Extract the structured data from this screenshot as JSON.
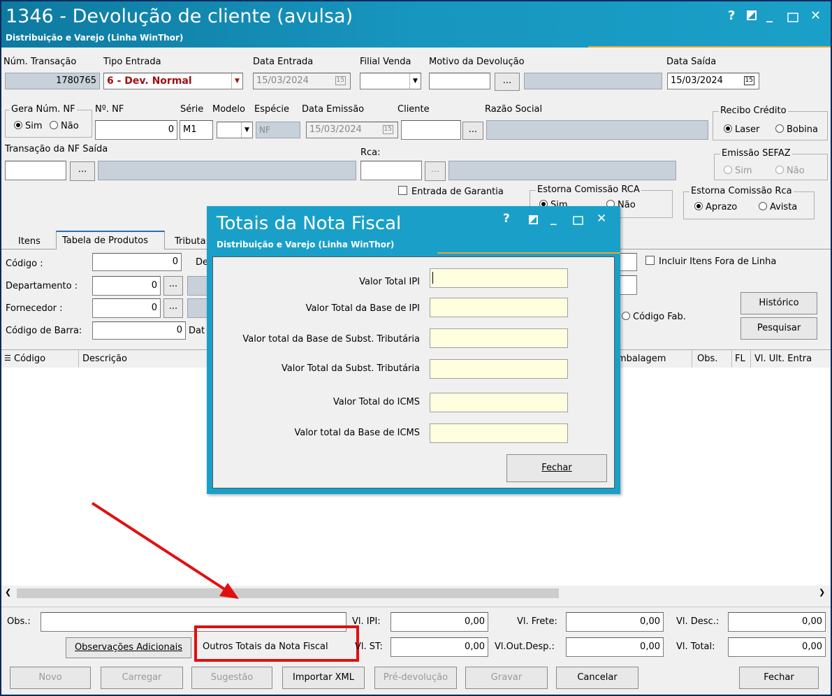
{
  "window": {
    "title": "1346 - Devolução de cliente (avulsa)",
    "subtitle": "Distribuição e Varejo (Linha WinThor)",
    "help": "?",
    "minimize": "_",
    "close": "✕"
  },
  "header": {
    "num_transacao_label": "Núm. Transação",
    "num_transacao_value": "1780765",
    "tipo_entrada_label": "Tipo Entrada",
    "tipo_entrada_value": "6 - Dev. Normal",
    "data_entrada_label": "Data Entrada",
    "data_entrada_value": "15/03/2024",
    "filial_venda_label": "Filial Venda",
    "motivo_label": "Motivo da Devolução",
    "data_saida_label": "Data Saída",
    "data_saida_value": "15/03/2024",
    "ellipsis": "..."
  },
  "nf": {
    "gera_label": "Gera Núm. NF",
    "sim": "Sim",
    "nao": "Não",
    "num_nf_label": "Nº. NF",
    "num_nf_value": "0",
    "serie_label": "Série",
    "serie_value": "M1",
    "modelo_label": "Modelo",
    "especie_label": "Espécie",
    "especie_value": "NF",
    "data_emissao_label": "Data Emissão",
    "data_emissao_value": "15/03/2024",
    "cliente_label": "Cliente",
    "razao_label": "Razão Social",
    "recibo_label": "Recibo Crédito",
    "laser": "Laser",
    "bobina": "Bobina",
    "transacao_saida_label": "Transação da NF Saída",
    "rca_label": "Rca:",
    "sefaz_label": "Emissão SEFAZ",
    "garantia_label": "Entrada de Garantia",
    "estorna_rca_label": "Estorna Comissão RCA",
    "estorna_rca_sim": "Sim",
    "estorna_rca_nao": "Não",
    "estorna_rca2_label": "Estorna Comissão Rca",
    "aprazo": "Aprazo",
    "avista": "Avista"
  },
  "tabs": {
    "itens": "Itens",
    "tabela": "Tabela de Produtos",
    "tributa": "Tributa"
  },
  "filters": {
    "codigo_label": "Código :",
    "codigo_value": "0",
    "de_label": "De",
    "departamento_label": "Departamento :",
    "departamento_value": "0",
    "fornecedor_label": "Fornecedor :",
    "fornecedor_value": "0",
    "codigo_barra_label": "Código de Barra:",
    "codigo_barra_value": "0",
    "dat_label": "Dat",
    "incluir_label": "Incluir Itens Fora de Linha",
    "codigo_fab_label": "Código Fab.",
    "historico": "Histórico",
    "pesquisar": "Pesquisar"
  },
  "grid": {
    "columns": [
      "Código",
      "Descrição",
      "mbalagem",
      "Obs.",
      "FL",
      "Vl. Ult. Entra"
    ]
  },
  "totals": {
    "obs_label": "Obs.:",
    "vl_ipi_label": "Vl. IPI:",
    "vl_ipi_value": "0,00",
    "vl_frete_label": "Vl. Frete:",
    "vl_frete_value": "0,00",
    "vl_desc_label": "Vl. Desc.:",
    "vl_desc_value": "0,00",
    "vl_st_label": "Vl. ST:",
    "vl_st_value": "0,00",
    "vl_outdesp_label": "Vl.Out.Desp.:",
    "vl_outdesp_value": "0,00",
    "vl_total_label": "Vl. Total:",
    "vl_total_value": "0,00",
    "obs_adicionais": "Observações Adicionais",
    "outros_totais": "Outros Totais da Nota Fiscal"
  },
  "bottom_buttons": {
    "novo": "Novo",
    "carregar": "Carregar",
    "sugestao": "Sugestão",
    "importar_xml": "Importar XML",
    "pre_devolucao": "Pré-devolução",
    "gravar": "Gravar",
    "cancelar": "Cancelar",
    "fechar": "Fechar"
  },
  "dialog": {
    "title": "Totais da Nota Fiscal",
    "subtitle": "Distribuição e Varejo (Linha WinThor)",
    "rows": [
      "Valor Total IPI",
      "Valor Total da Base de IPI",
      "Valor total  da Base de Subst. Tributária",
      "Valor Total da Subst. Tributária",
      "Valor Total do ICMS",
      "Valor total da Base de ICMS"
    ],
    "fechar": "Fechar"
  },
  "colors": {
    "titlebar": "#1796bf",
    "accent_orange": "#e8a53a",
    "highlight_red": "#e01010",
    "input_yellow": "#ffffe0",
    "tipo_entrada_text": "#a01010"
  }
}
